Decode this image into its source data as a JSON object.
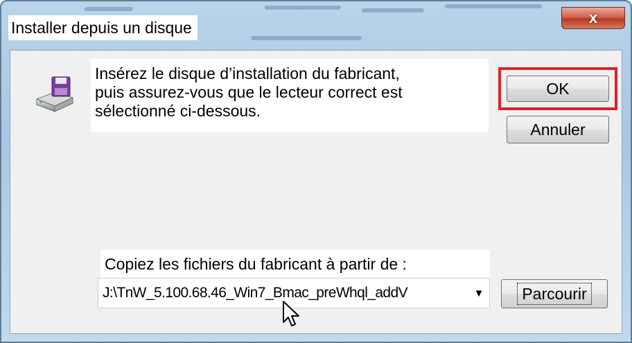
{
  "window": {
    "title": "Installer depuis un disque",
    "close_label": "x"
  },
  "message": {
    "line1": "Insérez le disque d’installation du fabricant,",
    "line2": "puis assurez-vous que le lecteur correct est",
    "line3": "sélectionné ci-dessous."
  },
  "buttons": {
    "ok_label": "OK",
    "cancel_label": "Annuler",
    "browse_label": "Parcourir"
  },
  "copy": {
    "label": "Copiez les fichiers du fabricant à partir de :",
    "path_value": "J:\\TnW_5.100.68.46_Win7_Bmac_preWhql_addV"
  },
  "icons": {
    "disk": "floppy-disk-drive-icon",
    "dropdown": "chevron-down-icon",
    "cursor": "mouse-pointer-icon"
  },
  "colors": {
    "highlight": "#e0202b",
    "close_button": "#c94a33",
    "title_bar": "#b9d4ea"
  }
}
